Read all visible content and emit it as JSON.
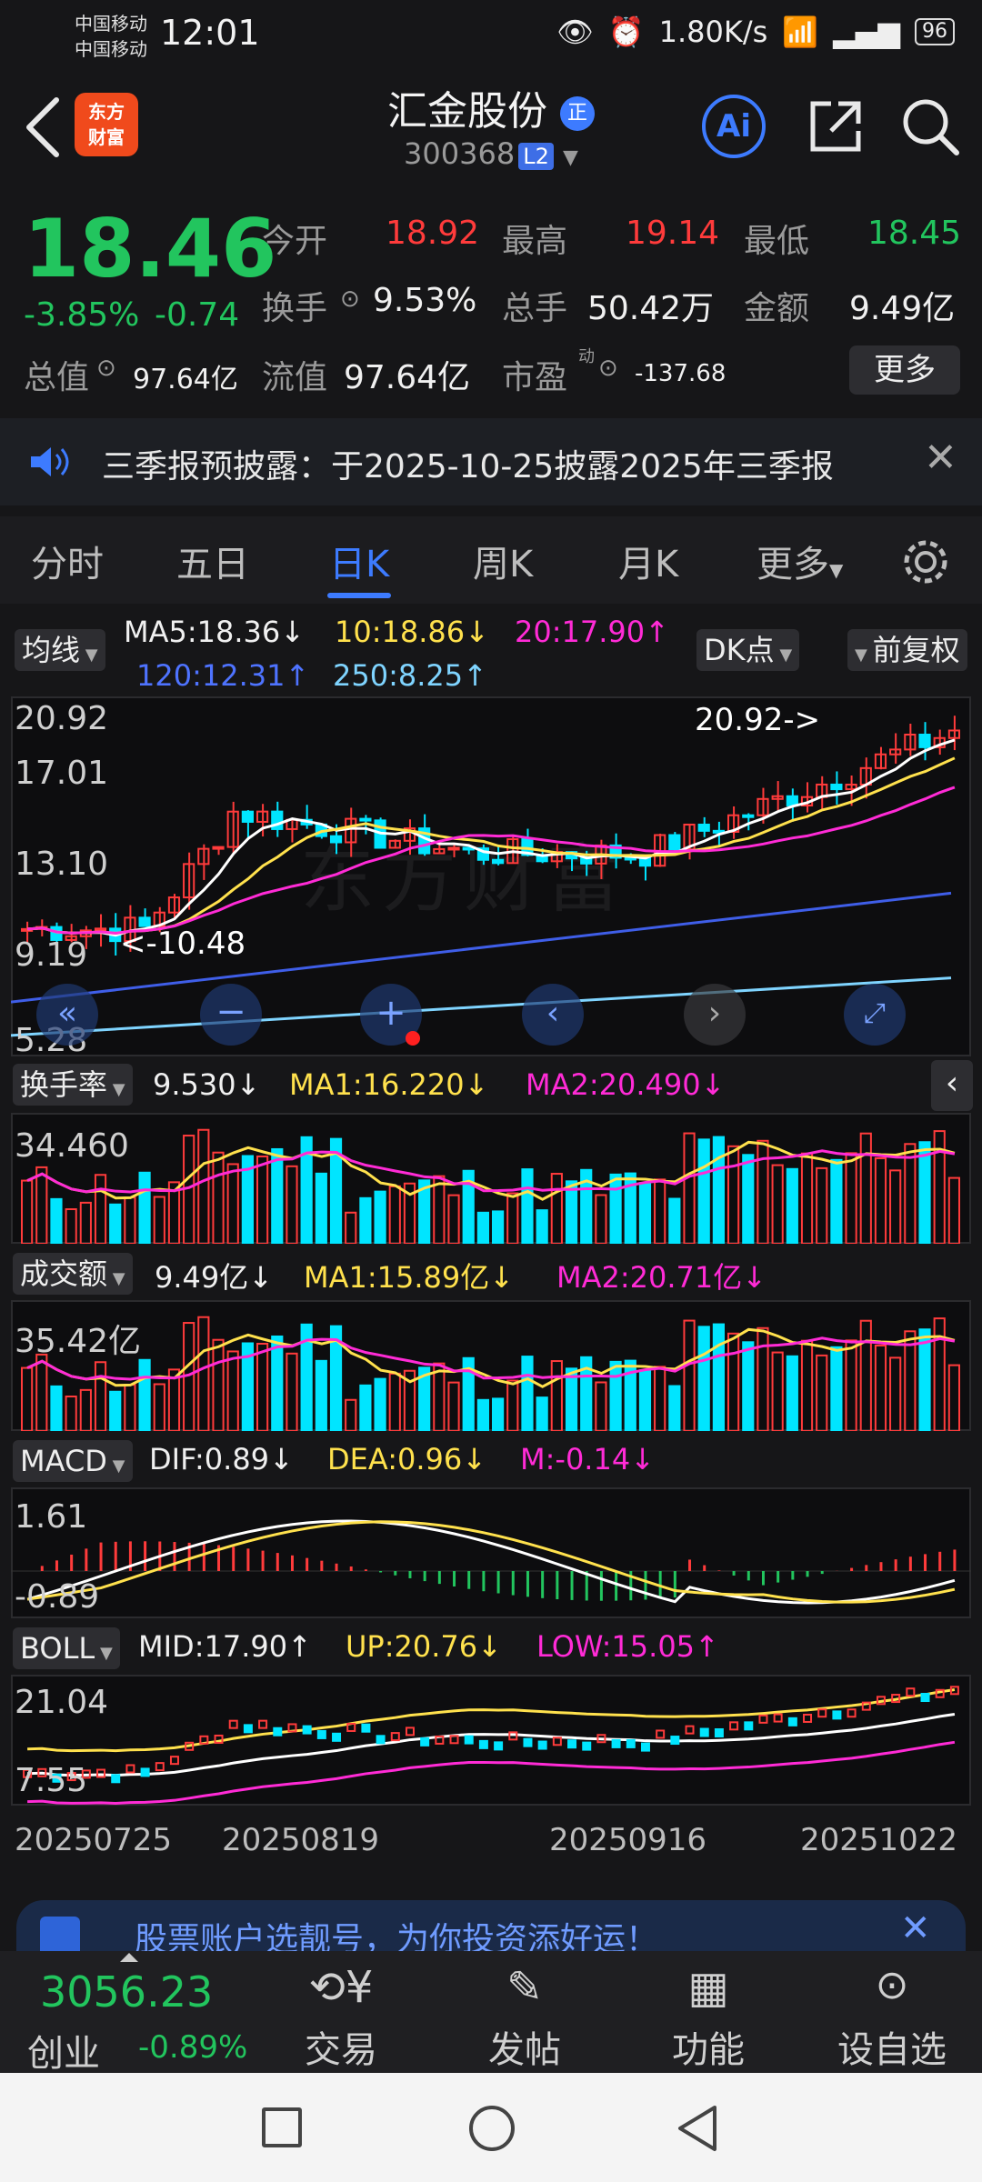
{
  "status": {
    "carrier1": "中国移动",
    "carrier2": "中国移动",
    "time": "12:01",
    "speed": "1.80K/s",
    "battery": "96"
  },
  "header": {
    "logo_line1": "东方",
    "logo_line2": "财富",
    "name": "汇金股份",
    "code": "300368",
    "level": "L2",
    "ai": "Ai"
  },
  "quote": {
    "price": "18.46",
    "change_pct": "-3.85%",
    "change_abs": "-0.74",
    "open_label": "今开",
    "open": "18.92",
    "high_label": "最高",
    "high": "19.14",
    "low_label": "最低",
    "low": "18.45",
    "turnover_label": "换手",
    "turnover": "9.53%",
    "volume_label": "总手",
    "volume": "50.42万",
    "amount_label": "金额",
    "amount": "9.49亿",
    "mktcap_label": "总值",
    "mktcap": "97.64亿",
    "float_label": "流值",
    "float_cap": "97.64亿",
    "pe_label": "市盈",
    "pe_sup": "动",
    "pe": "-137.68",
    "more": "更多"
  },
  "notice": {
    "text": "三季报预披露：于2025-10-25披露2025年三季报"
  },
  "tabs": [
    "分时",
    "五日",
    "日K",
    "周K",
    "月K",
    "更多"
  ],
  "kline": {
    "ma_tag": "均线",
    "ma5": "MA5:18.36↓",
    "ma10": "10:18.86↓",
    "ma20": "20:17.90↑",
    "ma120": "120:12.31↑",
    "ma250": "250:8.25↑",
    "dk": "DK点",
    "adjust": "前复权",
    "y_labels": [
      "20.92",
      "17.01",
      "13.10",
      "9.19",
      "5.28"
    ],
    "max_note": "20.92->",
    "min_note": "<-10.48",
    "watermark": "东方财富"
  },
  "turnover_panel": {
    "tag": "换手率",
    "val": "9.530↓",
    "ma1": "MA1:16.220↓",
    "ma2": "MA2:20.490↓",
    "ymax": "34.460"
  },
  "volume_panel": {
    "tag": "成交额",
    "val": "9.49亿↓",
    "ma1": "MA1:15.89亿↓",
    "ma2": "MA2:20.71亿↓",
    "ymax": "35.42亿"
  },
  "macd_panel": {
    "tag": "MACD",
    "dif": "DIF:0.89↓",
    "dea": "DEA:0.96↓",
    "m": "M:-0.14↓",
    "ymax": "1.61",
    "ymin": "-0.89"
  },
  "boll_panel": {
    "tag": "BOLL",
    "mid": "MID:17.90↑",
    "up": "UP:20.76↓",
    "low": "LOW:15.05↑",
    "ymax": "21.04",
    "ymin": "7.55"
  },
  "dates": [
    "20250725",
    "20250819",
    "20250916",
    "20251022"
  ],
  "promo": {
    "text": "股票账户选靓号，为你投资添好运！"
  },
  "bottom": {
    "index_value": "3056.23",
    "index_name": "创业",
    "index_chg": "-0.89%",
    "trade": "交易",
    "post": "发帖",
    "func": "功能",
    "watch": "设自选"
  },
  "colors": {
    "up": "#ff3b3b",
    "down": "#22c55e",
    "accent": "#3d7bff",
    "cyan": "#00e5ff",
    "ma_yellow": "#ffe14d",
    "ma_magenta": "#ff2bd6"
  }
}
